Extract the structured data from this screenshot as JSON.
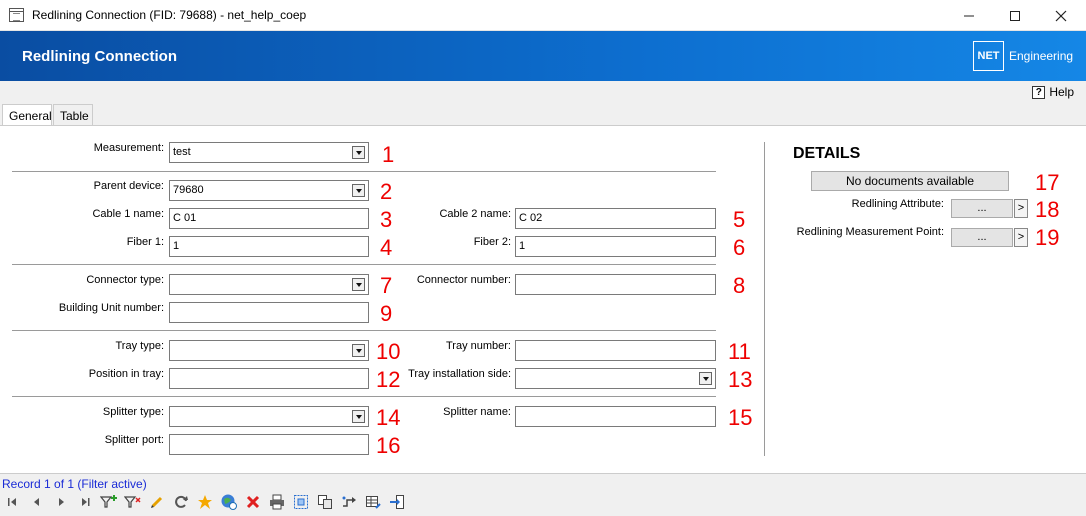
{
  "window": {
    "title": "Redlining Connection (FID: 79688) - net_help_coep"
  },
  "header": {
    "title": "Redlining Connection",
    "logo_box": "NET",
    "logo_text": "Engineering"
  },
  "help": {
    "label": "Help"
  },
  "tabs": [
    {
      "label": "General",
      "active": true
    },
    {
      "label": "Table",
      "active": false
    }
  ],
  "form": {
    "measurement": {
      "label": "Measurement:",
      "value": "test",
      "num": "1"
    },
    "parent_device": {
      "label": "Parent device:",
      "value": "79680",
      "num": "2"
    },
    "cable1": {
      "label": "Cable 1 name:",
      "value": "C 01",
      "num": "3"
    },
    "fiber1": {
      "label": "Fiber 1:",
      "value": "1",
      "num": "4"
    },
    "cable2": {
      "label": "Cable 2 name:",
      "value": "C 02",
      "num": "5"
    },
    "fiber2": {
      "label": "Fiber 2:",
      "value": "1",
      "num": "6"
    },
    "connector_type": {
      "label": "Connector type:",
      "value": "",
      "num": "7"
    },
    "connector_number": {
      "label": "Connector number:",
      "value": "",
      "num": "8"
    },
    "building_unit": {
      "label": "Building Unit number:",
      "value": "",
      "num": "9"
    },
    "tray_type": {
      "label": "Tray type:",
      "value": "",
      "num": "10"
    },
    "tray_number": {
      "label": "Tray number:",
      "value": "",
      "num": "11"
    },
    "position_in_tray": {
      "label": "Position in tray:",
      "value": "",
      "num": "12"
    },
    "tray_installation_side": {
      "label": "Tray installation side:",
      "value": "",
      "num": "13"
    },
    "splitter_type": {
      "label": "Splitter type:",
      "value": "",
      "num": "14"
    },
    "splitter_name": {
      "label": "Splitter name:",
      "value": "",
      "num": "15"
    },
    "splitter_port": {
      "label": "Splitter port:",
      "value": "",
      "num": "16"
    }
  },
  "details": {
    "title": "DETAILS",
    "no_docs": "No documents available",
    "no_docs_num": "17",
    "redlining_attribute": {
      "label": "Redlining Attribute:",
      "button": "...",
      "go": ">",
      "num": "18"
    },
    "redlining_point": {
      "label": "Redlining Measurement Point:",
      "button": "...",
      "go": ">",
      "num": "19"
    }
  },
  "status": {
    "record": "Record 1 of 1 (Filter active)"
  },
  "toolbar_icons": [
    "first-record-icon",
    "previous-record-icon",
    "next-record-icon",
    "last-record-icon",
    "add-filter-icon",
    "filter-icon",
    "edit-icon",
    "refresh-icon",
    "new-icon",
    "web-icon",
    "delete-icon",
    "print-icon",
    "select-icon",
    "copy-icon",
    "route-icon",
    "table-edit-icon",
    "exit-icon"
  ]
}
